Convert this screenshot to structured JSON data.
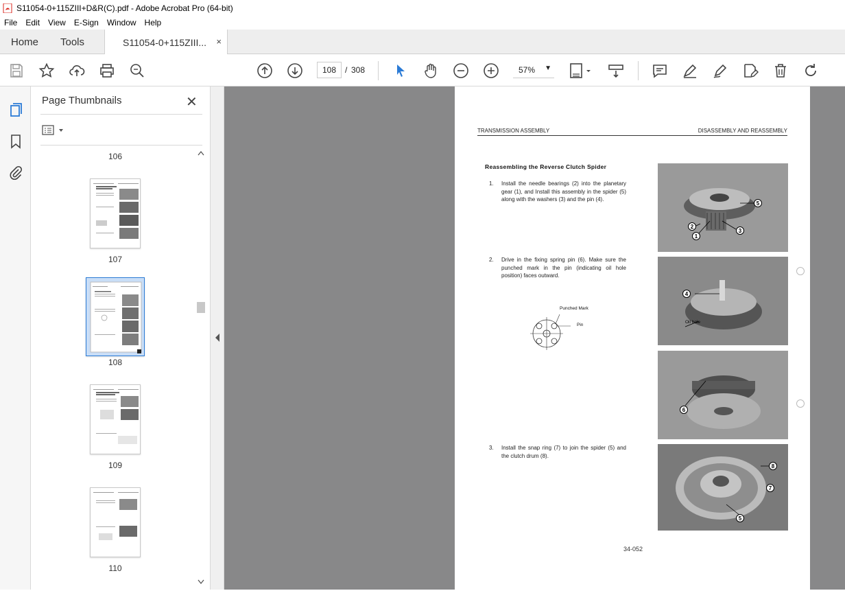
{
  "window": {
    "title": "S11054-0+115ZIII+D&R(C).pdf - Adobe Acrobat Pro (64-bit)"
  },
  "menu": {
    "items": [
      "File",
      "Edit",
      "View",
      "E-Sign",
      "Window",
      "Help"
    ]
  },
  "tabs": {
    "home": "Home",
    "tools": "Tools",
    "doc": "S11054-0+115ZIII...",
    "doc_close": "×"
  },
  "toolbar": {
    "current_page": "108",
    "page_separator": "/",
    "total_pages": "308",
    "zoom": "57%"
  },
  "thumbnails": {
    "title": "Page Thumbnails",
    "close": "✕",
    "pages": [
      "106",
      "107",
      "108",
      "109",
      "110"
    ],
    "selected": "108"
  },
  "document": {
    "header_left": "TRANSMISSION ASSEMBLY",
    "header_right": "DISASSEMBLY AND REASSEMBLY",
    "heading": "Reassembling the Reverse Clutch Spider",
    "steps": [
      {
        "num": "1.",
        "text": "Install the needle bearings (2) into the planetary gear (1), and Install this assembly in the spider (5) along with the washers (3) and the pin (4)."
      },
      {
        "num": "2.",
        "text": "Drive in the fixing spring pin (6). Make sure the punched mark in the pin (indicating oil hole position) faces outward."
      },
      {
        "num": "3.",
        "text": "Install the snap ring (7) to join the spider (5) and the clutch drum (8)."
      }
    ],
    "diagram_labels": {
      "punched": "Punched Mark",
      "pin": "Pin"
    },
    "photo_labels": {
      "oil_hole": "Oil hole"
    },
    "page_number": "34-052"
  },
  "colors": {
    "accent": "#2b7bd6",
    "viewer_bg": "#888889",
    "pdf_red": "#d9241c"
  }
}
